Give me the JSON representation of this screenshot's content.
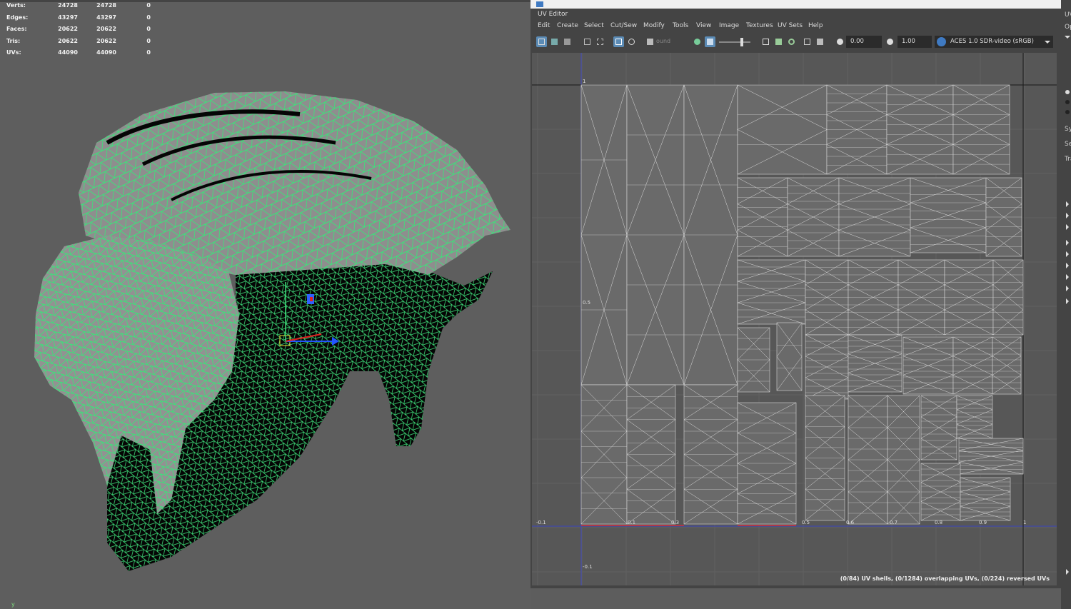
{
  "viewport": {
    "stats": [
      {
        "label": "Verts:",
        "v1": "24728",
        "v2": "24728",
        "v3": "0"
      },
      {
        "label": "Edges:",
        "v1": "43297",
        "v2": "43297",
        "v3": "0"
      },
      {
        "label": "Faces:",
        "v1": "20622",
        "v2": "20622",
        "v3": "0"
      },
      {
        "label": "Tris:",
        "v1": "20622",
        "v2": "20622",
        "v3": "0"
      },
      {
        "label": "UVs:",
        "v1": "44090",
        "v2": "44090",
        "v3": "0"
      }
    ],
    "axis_label": "y",
    "wire_color": "#3ee07a",
    "backface_color": "#050505",
    "surface_color": "#8a8a8a"
  },
  "uv_editor": {
    "title": "UV Editor",
    "menus": [
      "Edit",
      "Create",
      "Select",
      "Cut/Sew",
      "Modify",
      "Tools",
      "View",
      "Image",
      "Textures",
      "UV Sets",
      "Help"
    ],
    "snap_placeholder": "ound",
    "exposure": "0.00",
    "gamma": "1.00",
    "color_space": "ACES 1.0 SDR-video (sRGB)",
    "ticks_x": [
      "-0.1",
      "0.1",
      "0.3",
      "0.5",
      "0.6",
      "0.7",
      "0.8",
      "0.9",
      "1"
    ],
    "ticks_y": [
      "1",
      "0.5",
      "-0.1"
    ],
    "status": "(0/84) UV shells, (0/1284) overlapping UVs, (0/224) reversed UVs",
    "accent": "#5b8bb5"
  },
  "side_panel": {
    "labels": [
      "UV",
      "Op",
      "Sy",
      "Se",
      "Tra"
    ]
  }
}
